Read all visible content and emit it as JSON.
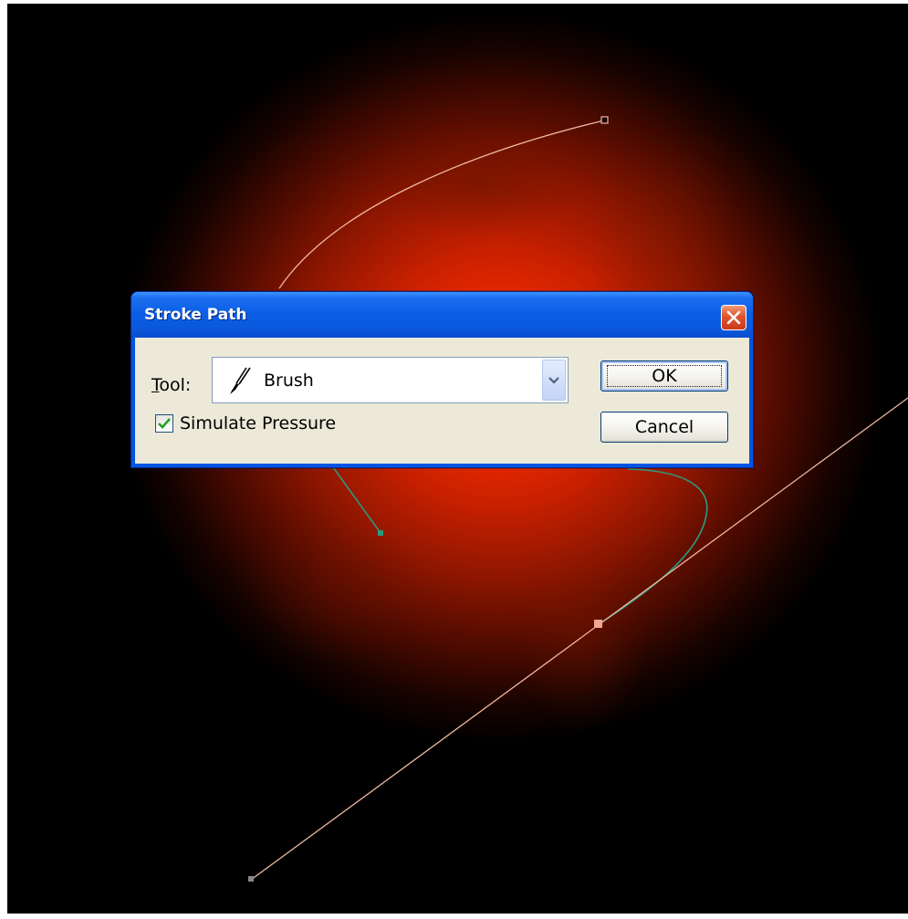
{
  "dialog": {
    "title": "Stroke Path",
    "tool_label": "Tool:",
    "tool_value": "Brush",
    "simulate_pressure_label": "Simulate Pressure",
    "simulate_pressure_checked": true,
    "ok_label": "OK",
    "cancel_label": "Cancel"
  },
  "icons": {
    "close": "close-icon",
    "tool": "brush-icon",
    "dropdown": "chevron-down-icon",
    "check": "checkmark-icon"
  },
  "colors": {
    "canvas_glow": "#ff3300",
    "path_line": "#f0b8a0",
    "active_path_line": "#2a9a80",
    "titlebar": "#0a5fe6",
    "dialog_face": "#ece9d8",
    "close_button": "#e0542c"
  }
}
